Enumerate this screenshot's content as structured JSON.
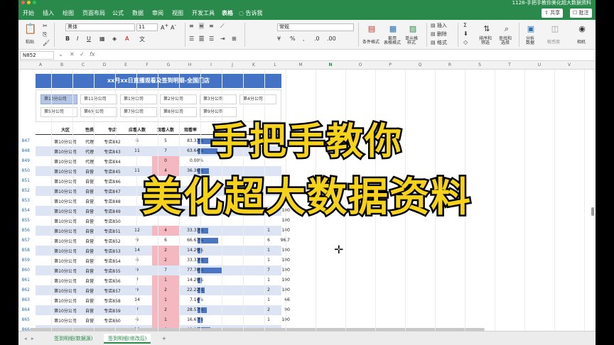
{
  "window": {
    "title": "1128-手把手教你美化超大数据资料",
    "accent": "#2a8a4b"
  },
  "menu": {
    "tabs": [
      "开始",
      "插入",
      "绘图",
      "页面布局",
      "公式",
      "数据",
      "审阅",
      "视图",
      "开发工具",
      "表格"
    ],
    "active_tab": "表格",
    "tell_me": "告诉我",
    "share": "共享",
    "comment": "批注"
  },
  "ribbon": {
    "paste": "粘贴",
    "font_name": "黑体",
    "font_size": "11",
    "number_format": "常规",
    "cond_format": "条件格式",
    "table_format": "套用\n表格格式",
    "cell_style": "单元格\n样式",
    "insert": "插入",
    "delete": "删除",
    "format": "格式",
    "sort_filter": "排序和\n筛选",
    "find_select": "查找和\n选择",
    "analyze": "分析\n数据",
    "sensitivity": "敏感度",
    "camera": "相机"
  },
  "formula": {
    "cell_ref": "N852",
    "fx": "fx",
    "value": ""
  },
  "columns": [
    "A",
    "B",
    "C",
    "D",
    "E",
    "F",
    "G",
    "H",
    "I",
    "J",
    "K",
    "L",
    "M",
    "N",
    "O",
    "P",
    "Q",
    "R",
    "S",
    "T",
    "U",
    "V",
    "W"
  ],
  "selected_column": "N",
  "sheet_title": "xx月xx日直播观看及签到明细-全国门店",
  "slicer": [
    [
      "第10分公司",
      "第11分公司",
      "第1分公司",
      "第2分公司",
      "第3分公司",
      "第4分公司"
    ],
    [
      "第5分公司",
      "第6分公司",
      "第7分公司",
      "第8分公司",
      "第9分公司"
    ]
  ],
  "table_headers": [
    "大区",
    "性质",
    "专店",
    "应看人数",
    "观看人数",
    "观看率"
  ],
  "rows": [
    {
      "num": "847",
      "region": "第10分公司",
      "type": "代理",
      "store": "专店842",
      "should": "6",
      "watched": "5",
      "rate": "83.33%",
      "bar": 0.83,
      "pink": false,
      "k": "",
      "l": ""
    },
    {
      "num": "848",
      "region": "第10分公司",
      "type": "代理",
      "store": "专店843",
      "should": "11",
      "watched": "7",
      "rate": "63.64%",
      "bar": 0.64,
      "pink": false,
      "k": "",
      "l": ""
    },
    {
      "num": "849",
      "region": "第10分公司",
      "type": "代理",
      "store": "专店844",
      "should": "",
      "watched": "0",
      "rate": "0.00%",
      "bar": 0,
      "pink": true,
      "k": "",
      "l": ""
    },
    {
      "num": "850",
      "region": "第10分公司",
      "type": "自营",
      "store": "专店845",
      "should": "11",
      "watched": "4",
      "rate": "36.36%",
      "bar": 0.36,
      "pink": true,
      "k": "",
      "l": ""
    },
    {
      "num": "851",
      "region": "第10分公司",
      "type": "自营",
      "store": "专店846",
      "should": "",
      "watched": "",
      "rate": "",
      "bar": 0,
      "pink": false,
      "k": "",
      "l": "100"
    },
    {
      "num": "852",
      "region": "第10分公司",
      "type": "自营",
      "store": "专店847",
      "should": "",
      "watched": "",
      "rate": "",
      "bar": 0,
      "pink": false,
      "k": "",
      "l": "100"
    },
    {
      "num": "853",
      "region": "第10分公司",
      "type": "自营",
      "store": "专店848",
      "should": "",
      "watched": "",
      "rate": "",
      "bar": 0,
      "pink": false,
      "k": "",
      "l": "100"
    },
    {
      "num": "854",
      "region": "第10分公司",
      "type": "自营",
      "store": "专店849",
      "should": "",
      "watched": "",
      "rate": "",
      "bar": 0,
      "pink": false,
      "k": "",
      "l": "100"
    },
    {
      "num": "855",
      "region": "第10分公司",
      "type": "自营",
      "store": "专店850",
      "should": "",
      "watched": "",
      "rate": "",
      "bar": 0,
      "pink": false,
      "k": "",
      "l": "100"
    },
    {
      "num": "856",
      "region": "第10分公司",
      "type": "自营",
      "store": "专店851",
      "should": "12",
      "watched": "4",
      "rate": "33.33%",
      "bar": 0.33,
      "pink": true,
      "k": "1",
      "l": "100"
    },
    {
      "num": "857",
      "region": "第10分公司",
      "type": "自营",
      "store": "专店852",
      "should": "9",
      "watched": "6",
      "rate": "66.67%",
      "bar": 0.67,
      "pink": false,
      "k": "6",
      "l": "96.7"
    },
    {
      "num": "858",
      "region": "第10分公司",
      "type": "自营",
      "store": "专店853",
      "should": "14",
      "watched": "2",
      "rate": "14.29%",
      "bar": 0.14,
      "pink": true,
      "k": "1",
      "l": "100"
    },
    {
      "num": "859",
      "region": "第10分公司",
      "type": "自营",
      "store": "专店854",
      "should": "6",
      "watched": "2",
      "rate": "33.33%",
      "bar": 0.33,
      "pink": true,
      "k": "1",
      "l": "100"
    },
    {
      "num": "860",
      "region": "第10分公司",
      "type": "自营",
      "store": "专店855",
      "should": "9",
      "watched": "7",
      "rate": "77.78%",
      "bar": 0.78,
      "pink": false,
      "k": "7",
      "l": "100"
    },
    {
      "num": "861",
      "region": "第10分公司",
      "type": "自营",
      "store": "专店856",
      "should": "7",
      "watched": "1",
      "rate": "14.29%",
      "bar": 0.14,
      "pink": true,
      "k": "1",
      "l": "100"
    },
    {
      "num": "862",
      "region": "第10分公司",
      "type": "自营",
      "store": "专店857",
      "should": "9",
      "watched": "2",
      "rate": "22.22%",
      "bar": 0.22,
      "pink": true,
      "k": "2",
      "l": "100"
    },
    {
      "num": "863",
      "region": "第10分公司",
      "type": "自营",
      "store": "专店858",
      "should": "14",
      "watched": "1",
      "rate": "7.14%",
      "bar": 0.07,
      "pink": true,
      "k": "1",
      "l": "66"
    },
    {
      "num": "864",
      "region": "第10分公司",
      "type": "自营",
      "store": "专店859",
      "should": "7",
      "watched": "2",
      "rate": "28.57%",
      "bar": 0.29,
      "pink": true,
      "k": "2",
      "l": "90"
    },
    {
      "num": "865",
      "region": "第10分公司",
      "type": "自营",
      "store": "专店860",
      "should": "6",
      "watched": "1",
      "rate": "16.67%",
      "bar": 0.17,
      "pink": true,
      "k": "1",
      "l": "100"
    },
    {
      "num": "866",
      "region": "第10分公司",
      "type": "自营",
      "store": "专店861",
      "should": "10",
      "watched": "4",
      "rate": "40.00%",
      "bar": 0.4,
      "pink": true,
      "k": "",
      "l": ""
    }
  ],
  "overlay": {
    "line1": "手把手教你",
    "line2": "美化超大数据资料",
    "color": "#f6d21a"
  },
  "sheet_tabs": [
    "签到明细(数据源)",
    "签到明细(修改后)"
  ],
  "active_sheet": "签到明细(修改后)",
  "add_sheet": "+"
}
